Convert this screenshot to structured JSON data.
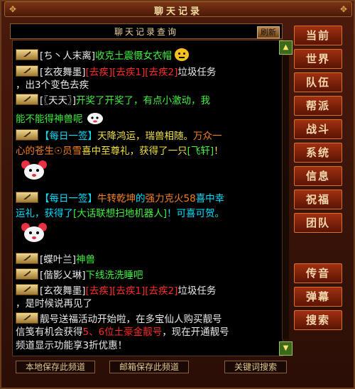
{
  "window": {
    "title": "聊天记录"
  },
  "panel": {
    "title": "聊天记录查询",
    "refresh_label": "刷新"
  },
  "messages": {
    "m1": {
      "name": "[ち丶人末离]",
      "text": "收克土震慑女衣帽"
    },
    "m2": {
      "name": "[玄夜舞墨]",
      "t1": "[去疾]",
      "t2": "[去疾1]",
      "t3": "[去疾2]",
      "t4": "垃圾任务",
      "line2": "，出3个变色去疾"
    },
    "m3": {
      "name": "[〖天天〗]",
      "text": "开奖了开奖了，有点小激动，我",
      "line2": "能不能得神兽呢"
    },
    "m4": {
      "tag": "【每日一签】",
      "t1": "天降鸿运，瑞兽相随。",
      "t2": "万众一",
      "l2a": "心的",
      "l2b": "苍生☉员雪",
      "l2c": "喜中至尊礼，获得了一只",
      "l2d": "[飞轩]",
      "l2e": "！"
    },
    "m5": {
      "tag": "【每日一签】",
      "t1": "牛转乾坤",
      "t2": "的",
      "t3": "强力克火58",
      "t4": "喜中幸",
      "l2a": "运礼，获得了",
      "l2b": "[大话联想扫地机器人]",
      "l2c": "！可喜可贺。"
    },
    "m6": {
      "name": "[蝶叶兰]",
      "text": "神兽"
    },
    "m7": {
      "name": "[偕影乂琳]",
      "text": "下线洗洗睡吧"
    },
    "m8": {
      "name": "[玄夜舞墨]",
      "t1": "[去疾]",
      "t2": "[去疾1]",
      "t3": "[去疾2]",
      "t4": "垃圾任务",
      "line2": "，是时候说再见了"
    },
    "m9": {
      "t1": "靓号送福活动开始啦，在多宝仙人购买靓号",
      "l2a": "信笺有机会获得",
      "l2b": "5、6位土豪金靓号",
      "l2c": "，现在开通靓号",
      "line3": "频道显示功能享3折优惠！"
    }
  },
  "sidebar": {
    "items": [
      "当前",
      "世界",
      "队伍",
      "帮派",
      "战斗",
      "系统",
      "信息",
      "祝福",
      "团队",
      "传音",
      "弹幕",
      "搜索"
    ]
  },
  "bottom": {
    "save_local": "本地保存此频道",
    "save_mail": "邮箱保存此频道",
    "keyword_search": "关键词搜索"
  },
  "colors": {
    "channel_green": "#40f040",
    "name_cyan": "#00e0ff",
    "task_red": "#ff2a2a",
    "accent": "#a03010"
  }
}
